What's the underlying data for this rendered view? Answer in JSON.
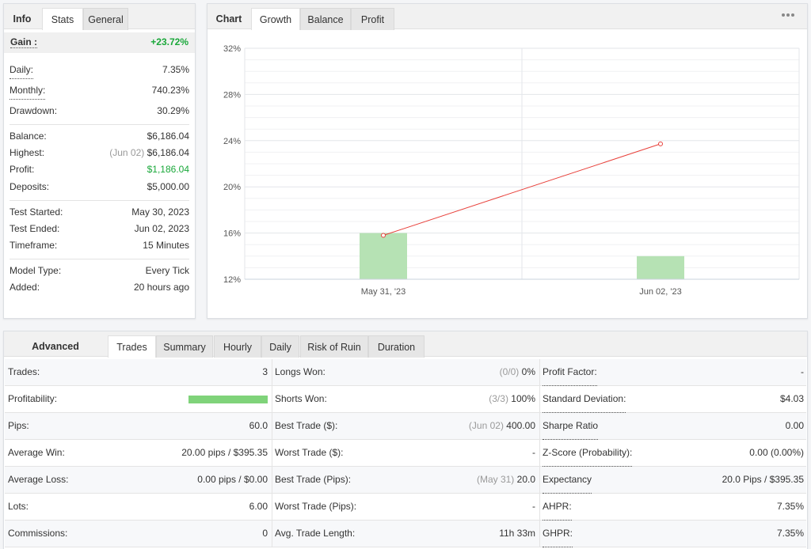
{
  "stats_panel": {
    "tabs": [
      "Info",
      "Stats",
      "General"
    ],
    "gain": {
      "label": "Gain :",
      "value": "+23.72%"
    },
    "group1": [
      {
        "label": "Daily:",
        "value": "7.35%"
      },
      {
        "label": "Monthly:",
        "value": "740.23%"
      },
      {
        "label": "Drawdown:",
        "value": "30.29%"
      }
    ],
    "group2": [
      {
        "label": "Balance:",
        "value": "$6,186.04"
      },
      {
        "label": "Highest:",
        "note": "(Jun 02)",
        "value": "$6,186.04"
      },
      {
        "label": "Profit:",
        "value": "$1,186.04"
      },
      {
        "label": "Deposits:",
        "value": "$5,000.00"
      }
    ],
    "group3": [
      {
        "label": "Test Started:",
        "value": "May 30, 2023"
      },
      {
        "label": "Test Ended:",
        "value": "Jun 02, 2023"
      },
      {
        "label": "Timeframe:",
        "value": "15 Minutes"
      }
    ],
    "group4": [
      {
        "label": "Model Type:",
        "value": "Every Tick"
      },
      {
        "label": "Added:",
        "value": "20 hours ago"
      }
    ]
  },
  "chart_panel": {
    "tabs": [
      "Chart",
      "Growth",
      "Balance",
      "Profit"
    ],
    "more_icon": "more-dots-icon",
    "chart_data": {
      "type": "bar",
      "categories": [
        "May 31, '23",
        "Jun 02, '23"
      ],
      "series": [
        {
          "type": "bar",
          "values": [
            16,
            14
          ],
          "color": "#b6e2b4"
        },
        {
          "type": "line",
          "values": [
            15.8,
            23.72
          ],
          "color": "#e8403a"
        }
      ],
      "ylim": [
        12,
        32
      ],
      "yticks": [
        "12%",
        "16%",
        "20%",
        "24%",
        "28%",
        "32%"
      ],
      "grid": true
    }
  },
  "advanced": {
    "title": "Advanced Statistics",
    "tabs": [
      "Trades",
      "Summary",
      "Hourly",
      "Daily",
      "Risk of Ruin",
      "Duration"
    ],
    "rows": [
      [
        {
          "label": "Trades:",
          "value": "3"
        },
        {
          "label": "Longs Won:",
          "note": "(0/0)",
          "value": "0%"
        },
        {
          "label": "Profit Factor:",
          "value": "-"
        }
      ],
      [
        {
          "label": "Profitability:",
          "bar": 1.0
        },
        {
          "label": "Shorts Won:",
          "note": "(3/3)",
          "value": "100%"
        },
        {
          "label": "Standard Deviation:",
          "value": "$4.03"
        }
      ],
      [
        {
          "label": "Pips:",
          "value": "60.0"
        },
        {
          "label": "Best Trade ($):",
          "note": "(Jun 02)",
          "value": "400.00"
        },
        {
          "label": "Sharpe Ratio",
          "value": "0.00"
        }
      ],
      [
        {
          "label": "Average Win:",
          "value": "20.00 pips / $395.35"
        },
        {
          "label": "Worst Trade ($):",
          "value": "-"
        },
        {
          "label": "Z-Score (Probability):",
          "value": "0.00 (0.00%)"
        }
      ],
      [
        {
          "label": "Average Loss:",
          "value": "0.00 pips / $0.00"
        },
        {
          "label": "Best Trade (Pips):",
          "note": "(May 31)",
          "value": "20.0"
        },
        {
          "label": "Expectancy",
          "value": "20.0 Pips / $395.35"
        }
      ],
      [
        {
          "label": "Lots:",
          "value": "6.00"
        },
        {
          "label": "Worst Trade (Pips):",
          "value": "-"
        },
        {
          "label": "AHPR:",
          "value": "7.35%"
        }
      ],
      [
        {
          "label": "Commissions:",
          "value": "0"
        },
        {
          "label": "Avg. Trade Length:",
          "value": "11h 33m"
        },
        {
          "label": "GHPR:",
          "value": "7.35%"
        }
      ]
    ]
  }
}
